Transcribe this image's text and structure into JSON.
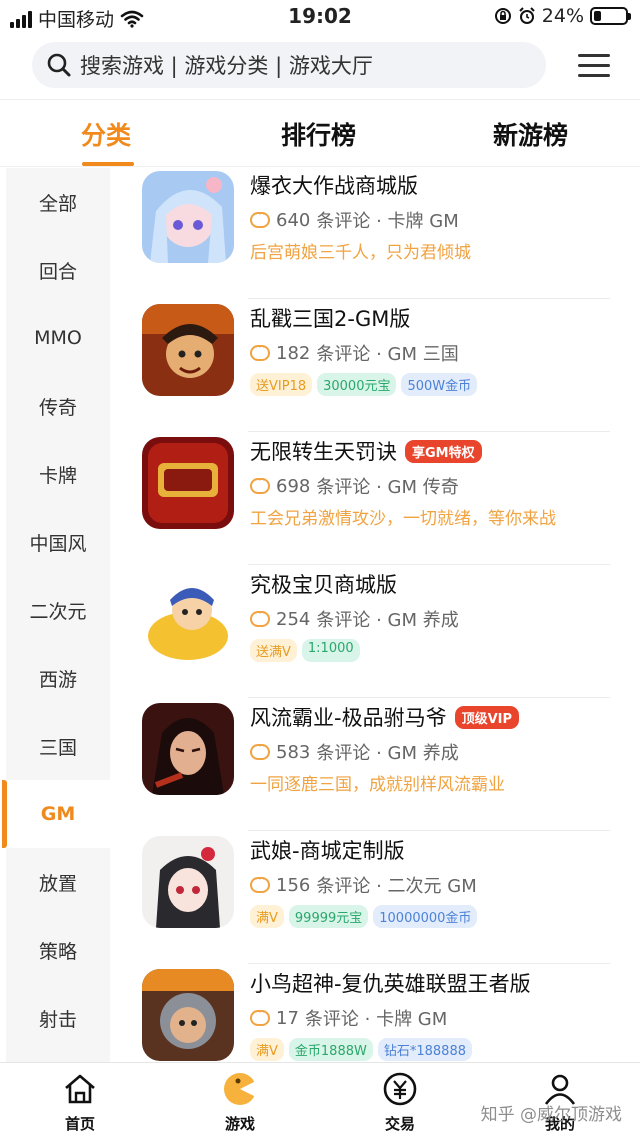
{
  "status_bar": {
    "carrier": "中国移动",
    "time": "19:02",
    "battery": "24%",
    "battery_level": 0.24
  },
  "search": {
    "placeholder": "搜索游戏 | 游戏分类 | 游戏大厅",
    "icon": "search-icon"
  },
  "tabs": [
    {
      "label": "分类",
      "active": true
    },
    {
      "label": "排行榜",
      "active": false
    },
    {
      "label": "新游榜",
      "active": false
    }
  ],
  "sidebar": {
    "items": [
      {
        "label": "全部"
      },
      {
        "label": "回合"
      },
      {
        "label": "MMO"
      },
      {
        "label": "传奇"
      },
      {
        "label": "卡牌"
      },
      {
        "label": "中国风"
      },
      {
        "label": "二次元"
      },
      {
        "label": "西游"
      },
      {
        "label": "三国"
      },
      {
        "label": "GM"
      },
      {
        "label": "放置"
      },
      {
        "label": "策略"
      },
      {
        "label": "射击"
      }
    ],
    "active": "GM"
  },
  "games": [
    {
      "title": "爆衣大作战商城版",
      "badge": "",
      "reviews": "640",
      "meta": "条评论 · 卡牌 GM",
      "desc": "后宫萌娘三千人，只为君倾城",
      "tags": []
    },
    {
      "title": "乱戳三国2-GM版",
      "badge": "",
      "reviews": "182",
      "meta": "条评论 · GM 三国",
      "desc": "",
      "tags": [
        {
          "text": "送VIP18",
          "color": "yellow"
        },
        {
          "text": "30000元宝",
          "color": "green"
        },
        {
          "text": "500W金币",
          "color": "blue"
        }
      ]
    },
    {
      "title": "无限转生天罚诀",
      "badge": "享GM特权",
      "reviews": "698",
      "meta": "条评论 · GM 传奇",
      "desc": "工会兄弟激情攻沙，一切就绪，等你来战",
      "tags": []
    },
    {
      "title": "究极宝贝商城版",
      "badge": "",
      "reviews": "254",
      "meta": "条评论 · GM 养成",
      "desc": "",
      "tags": [
        {
          "text": "送满V",
          "color": "yellow"
        },
        {
          "text": "1:1000",
          "color": "green"
        }
      ]
    },
    {
      "title": "风流霸业-极品驸马爷",
      "badge": "顶级VIP",
      "reviews": "583",
      "meta": "条评论 · GM 养成",
      "desc": "一同逐鹿三国，成就别样风流霸业",
      "tags": []
    },
    {
      "title": "武娘-商城定制版",
      "badge": "",
      "reviews": "156",
      "meta": "条评论 · 二次元 GM",
      "desc": "",
      "tags": [
        {
          "text": "满V",
          "color": "yellow"
        },
        {
          "text": "99999元宝",
          "color": "green"
        },
        {
          "text": "10000000金币",
          "color": "blue"
        }
      ]
    },
    {
      "title": "小鸟超神-复仇英雄联盟王者版",
      "badge": "",
      "reviews": "17",
      "meta": "条评论 · 卡牌 GM",
      "desc": "",
      "tags": [
        {
          "text": "满V",
          "color": "yellow"
        },
        {
          "text": "金币1888W",
          "color": "green"
        },
        {
          "text": "钻石*188888",
          "color": "blue"
        }
      ]
    }
  ],
  "bottom_nav": [
    {
      "label": "首页",
      "icon": "home-icon"
    },
    {
      "label": "游戏",
      "icon": "game-icon",
      "active": true
    },
    {
      "label": "交易",
      "icon": "trade-icon"
    },
    {
      "label": "我的",
      "icon": "user-icon"
    }
  ],
  "watermark": "知乎 @威尔顶游戏",
  "colors": {
    "accent": "#f08a1c",
    "badge_red": "#e8452c"
  }
}
